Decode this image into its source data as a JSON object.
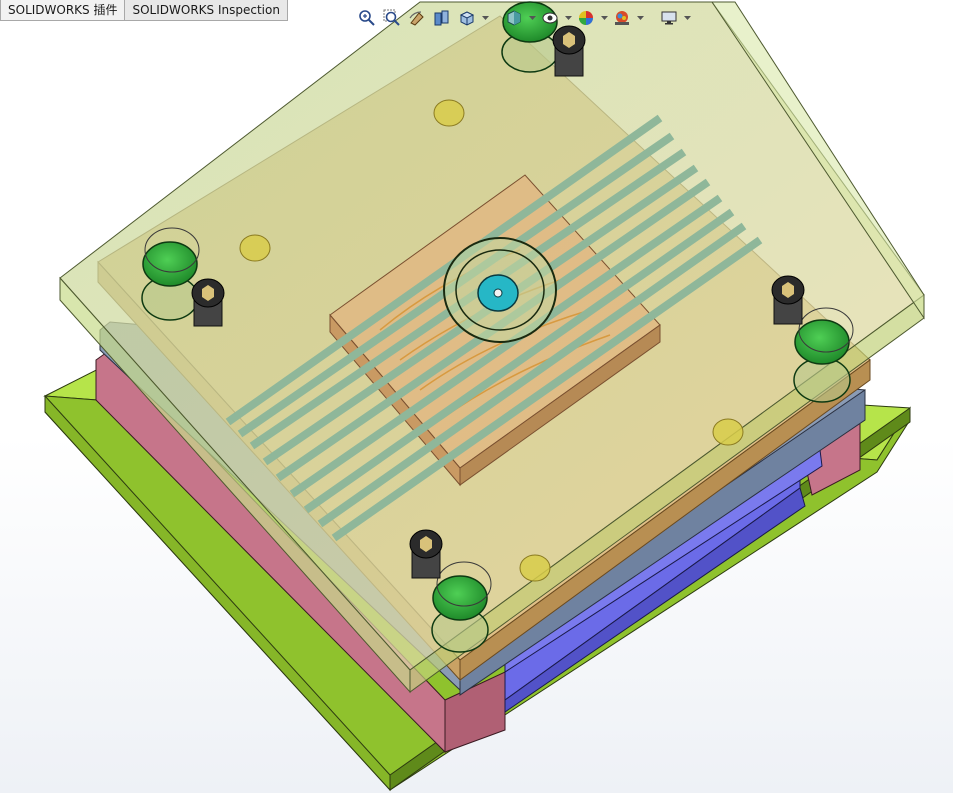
{
  "tabs": [
    {
      "label": "SOLIDWORKS 插件"
    },
    {
      "label": "SOLIDWORKS Inspection"
    }
  ],
  "heads_up_toolbar": {
    "icons": [
      "zoom-to-fit-icon",
      "zoom-to-area-icon",
      "previous-view-icon",
      "section-view-icon",
      "view-orientation-icon",
      "display-style-icon",
      "hide-show-items-icon",
      "edit-appearance-icon",
      "apply-scene-icon",
      "view-settings-icon"
    ]
  },
  "colors": {
    "base_plate": "#a9de3c",
    "side_plate_pink": "#c97a8e",
    "transparent_plate": "#d6e8a0",
    "cavity_plate": "#d9b878",
    "ejector_blue": "#6a6ae6",
    "guide_pin_green": "#2fa83a",
    "cooling_pipe": "#8fb79a",
    "sprue": "#25b8c7"
  }
}
